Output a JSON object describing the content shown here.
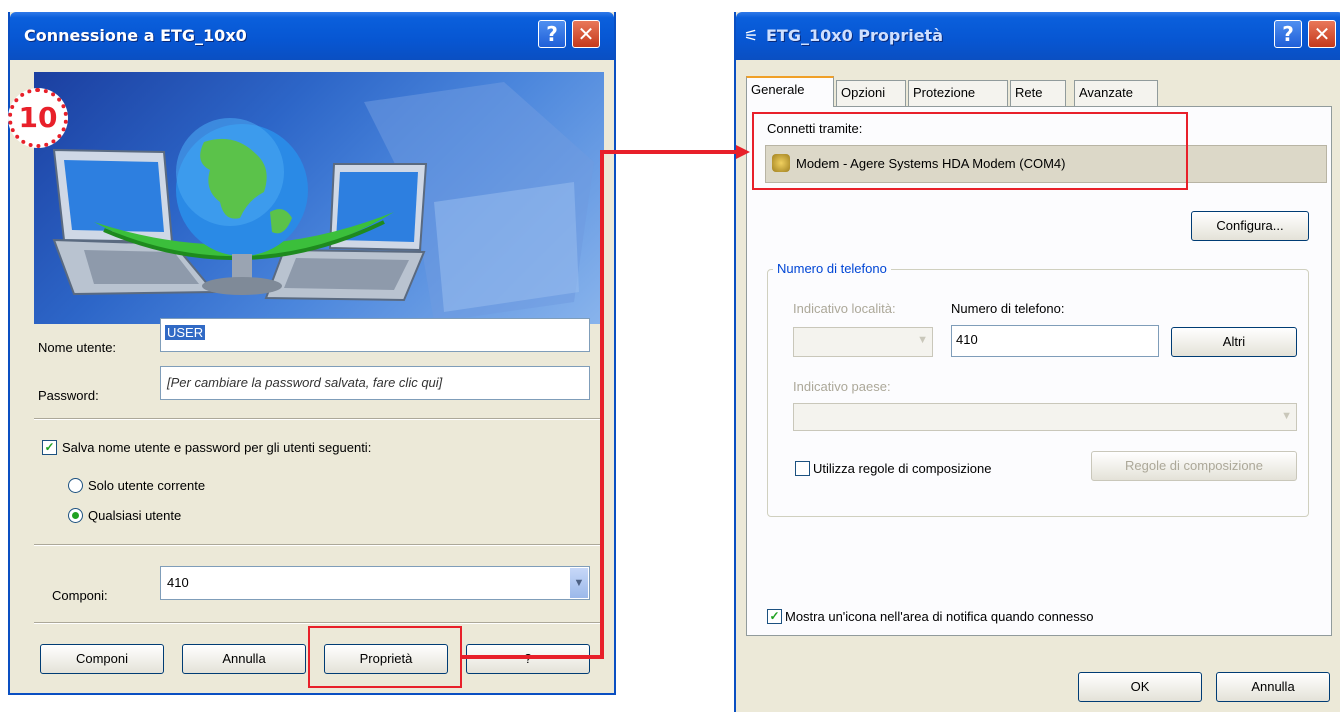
{
  "left_dialog": {
    "title": "Connessione a ETG_10x0",
    "step_badge": "10",
    "username_label": "Nome utente:",
    "username_value": "USER",
    "password_label": "Password:",
    "password_value": "[Per cambiare la password salvata, fare clic qui]",
    "save_checkbox_label": "Salva nome utente e password per gli utenti seguenti:",
    "save_checked": true,
    "radio_current_user": "Solo utente corrente",
    "radio_any_user": "Qualsiasi utente",
    "selected_radio": "Qualsiasi utente",
    "dial_label": "Componi:",
    "dial_value": "410",
    "buttons": {
      "dial": "Componi",
      "cancel": "Annulla",
      "properties": "Proprietà",
      "help": "?"
    }
  },
  "right_dialog": {
    "title": "ETG_10x0 Proprietà",
    "tabs": [
      "Generale",
      "Opzioni",
      "Protezione",
      "Rete",
      "Avanzate"
    ],
    "active_tab": "Generale",
    "connect_using_label": "Connetti tramite:",
    "device": "Modem - Agere Systems HDA Modem (COM4)",
    "configure_button": "Configura...",
    "phone_group_title": "Numero di telefono",
    "area_code_label": "Indicativo località:",
    "phone_number_label": "Numero di telefono:",
    "phone_number_value": "410",
    "others_button": "Altri",
    "country_code_label": "Indicativo paese:",
    "use_dialing_rules_label": "Utilizza regole di composizione",
    "use_dialing_rules_checked": false,
    "dialing_rules_button": "Regole di composizione",
    "show_icon_label": "Mostra un'icona nell'area di notifica quando connesso",
    "show_icon_checked": true,
    "ok_button": "OK",
    "cancel_button": "Annulla"
  },
  "colors": {
    "titlebar": "#0756d2",
    "dialog_bg": "#ece9d8",
    "highlight": "#e8202a",
    "badge": "#e8202a"
  }
}
